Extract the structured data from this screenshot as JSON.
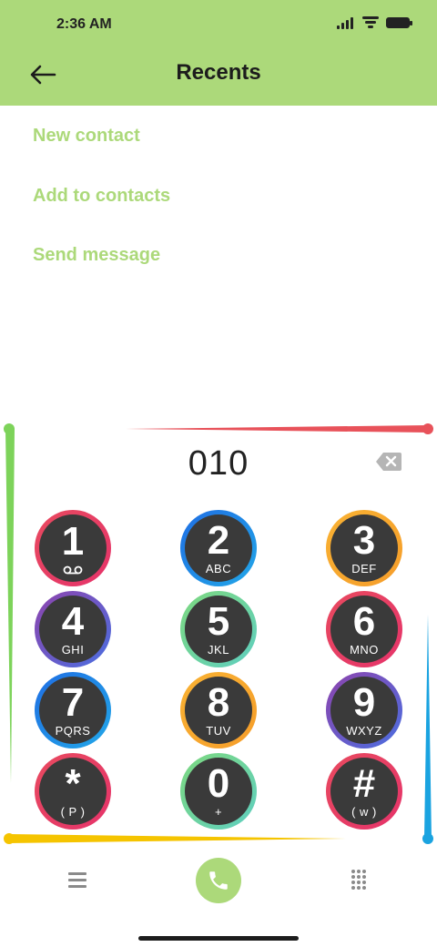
{
  "status_bar": {
    "time": "2:36 AM"
  },
  "header": {
    "title": "Recents"
  },
  "options": [
    {
      "label": "New contact"
    },
    {
      "label": "Add to contacts"
    },
    {
      "label": "Send message"
    }
  ],
  "dialer": {
    "number": "010",
    "keys": [
      {
        "digit": "1",
        "sub": "",
        "ring": [
          "#e84a5f",
          "#e5336a"
        ]
      },
      {
        "digit": "2",
        "sub": "ABC",
        "ring": [
          "#1f6ee3",
          "#22a7e8"
        ]
      },
      {
        "digit": "3",
        "sub": "DEF",
        "ring": [
          "#f9b233",
          "#f59d2a"
        ]
      },
      {
        "digit": "4",
        "sub": "GHI",
        "ring": [
          "#8e44ad",
          "#4a6ee0"
        ]
      },
      {
        "digit": "5",
        "sub": "JKL",
        "ring": [
          "#7dd87f",
          "#5fcfc0"
        ]
      },
      {
        "digit": "6",
        "sub": "MNO",
        "ring": [
          "#e84a5f",
          "#e5336a"
        ]
      },
      {
        "digit": "7",
        "sub": "PQRS",
        "ring": [
          "#1f6ee3",
          "#22a7e8"
        ]
      },
      {
        "digit": "8",
        "sub": "TUV",
        "ring": [
          "#f9b233",
          "#f59d2a"
        ]
      },
      {
        "digit": "9",
        "sub": "WXYZ",
        "ring": [
          "#8e44ad",
          "#4a6ee0"
        ]
      },
      {
        "digit": "*",
        "sub": "( P )",
        "ring": [
          "#e84a5f",
          "#e5336a"
        ]
      },
      {
        "digit": "0",
        "sub": "+",
        "ring": [
          "#7dd87f",
          "#5fcfc0"
        ]
      },
      {
        "digit": "#",
        "sub": "( w )",
        "ring": [
          "#e84a5f",
          "#e5336a"
        ]
      }
    ]
  },
  "colors": {
    "accent": "#acd97a",
    "key_fill": "#3a3a3a",
    "line_left": "#7dd35a",
    "line_top": "#e8525a",
    "line_right": "#1aa3e0",
    "line_bottom": "#f5c400"
  }
}
